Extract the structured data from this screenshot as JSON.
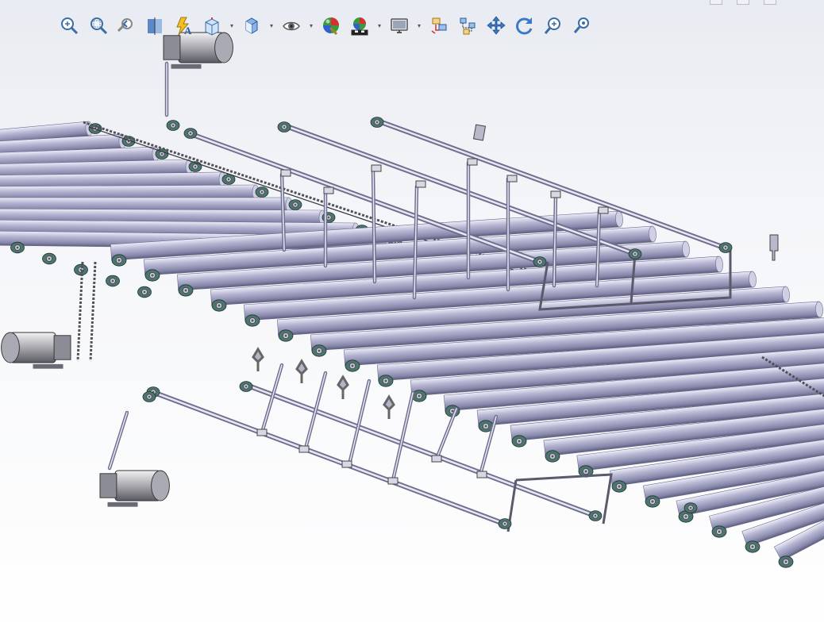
{
  "toolbar": {
    "tools": [
      {
        "id": "zoom-to-fit",
        "icon": "zoom-to-fit-icon"
      },
      {
        "id": "zoom-to-area",
        "icon": "zoom-to-area-icon"
      },
      {
        "id": "previous-view",
        "icon": "previous-view-icon"
      },
      {
        "id": "section-view",
        "icon": "section-view-icon"
      },
      {
        "id": "dynamic-annotation",
        "icon": "dynamic-annotation-icon"
      },
      {
        "id": "view-orientation",
        "icon": "view-orientation-icon",
        "dropdown": true
      },
      {
        "id": "display-style",
        "icon": "display-style-icon",
        "dropdown": true
      },
      {
        "id": "hide-show-items",
        "icon": "hide-show-eye-icon",
        "dropdown": true
      },
      {
        "id": "edit-appearance",
        "icon": "appearance-sphere-icon"
      },
      {
        "id": "apply-scene",
        "icon": "scene-icon",
        "dropdown": true
      },
      {
        "id": "view-settings",
        "icon": "monitor-icon",
        "dropdown": true
      },
      {
        "id": "exploded-view",
        "icon": "exploded-view-icon"
      },
      {
        "id": "explode-line-sketch",
        "icon": "explode-line-icon"
      },
      {
        "id": "pan",
        "icon": "pan-arrows-icon"
      },
      {
        "id": "rotate",
        "icon": "rotate-icon"
      },
      {
        "id": "zoom-in-out",
        "icon": "zoom-in-out-icon"
      },
      {
        "id": "zoom-to-selection",
        "icon": "zoom-selection-icon"
      }
    ]
  },
  "colors": {
    "roller": "#a8a8c8",
    "roller_highlight": "#e4e4f4",
    "roller_shadow": "#6a6a8c",
    "bearing": "#4f7470",
    "motor": "#9a9aa0",
    "frame": "#6a6a7a",
    "chain": "#505058"
  }
}
